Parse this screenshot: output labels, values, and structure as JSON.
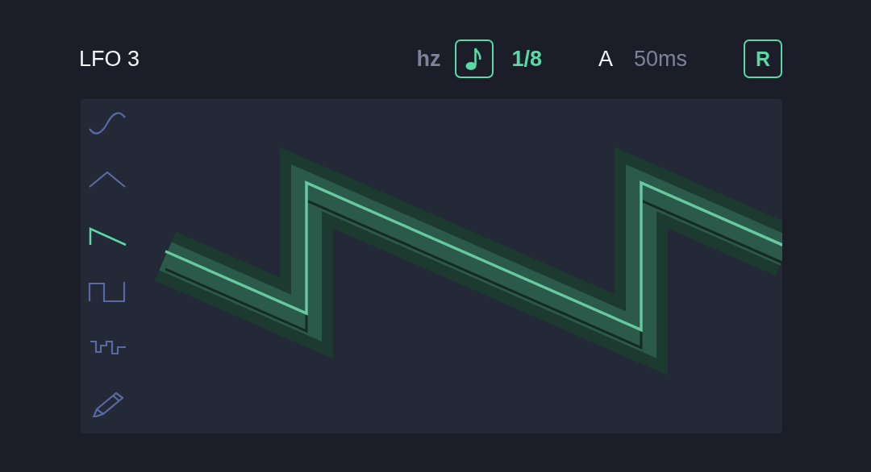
{
  "title": "LFO 3",
  "hz_label": "hz",
  "tempo_sync": {
    "on": true
  },
  "rate": "1/8",
  "attack": {
    "label": "A",
    "value": "50ms"
  },
  "retrigger": {
    "label": "R",
    "on": true
  },
  "shapes": [
    {
      "kind": "sine",
      "selected": false
    },
    {
      "kind": "triangle",
      "selected": false
    },
    {
      "kind": "saw",
      "selected": true
    },
    {
      "kind": "square",
      "selected": false
    },
    {
      "kind": "random",
      "selected": false
    },
    {
      "kind": "draw",
      "selected": false
    }
  ]
}
